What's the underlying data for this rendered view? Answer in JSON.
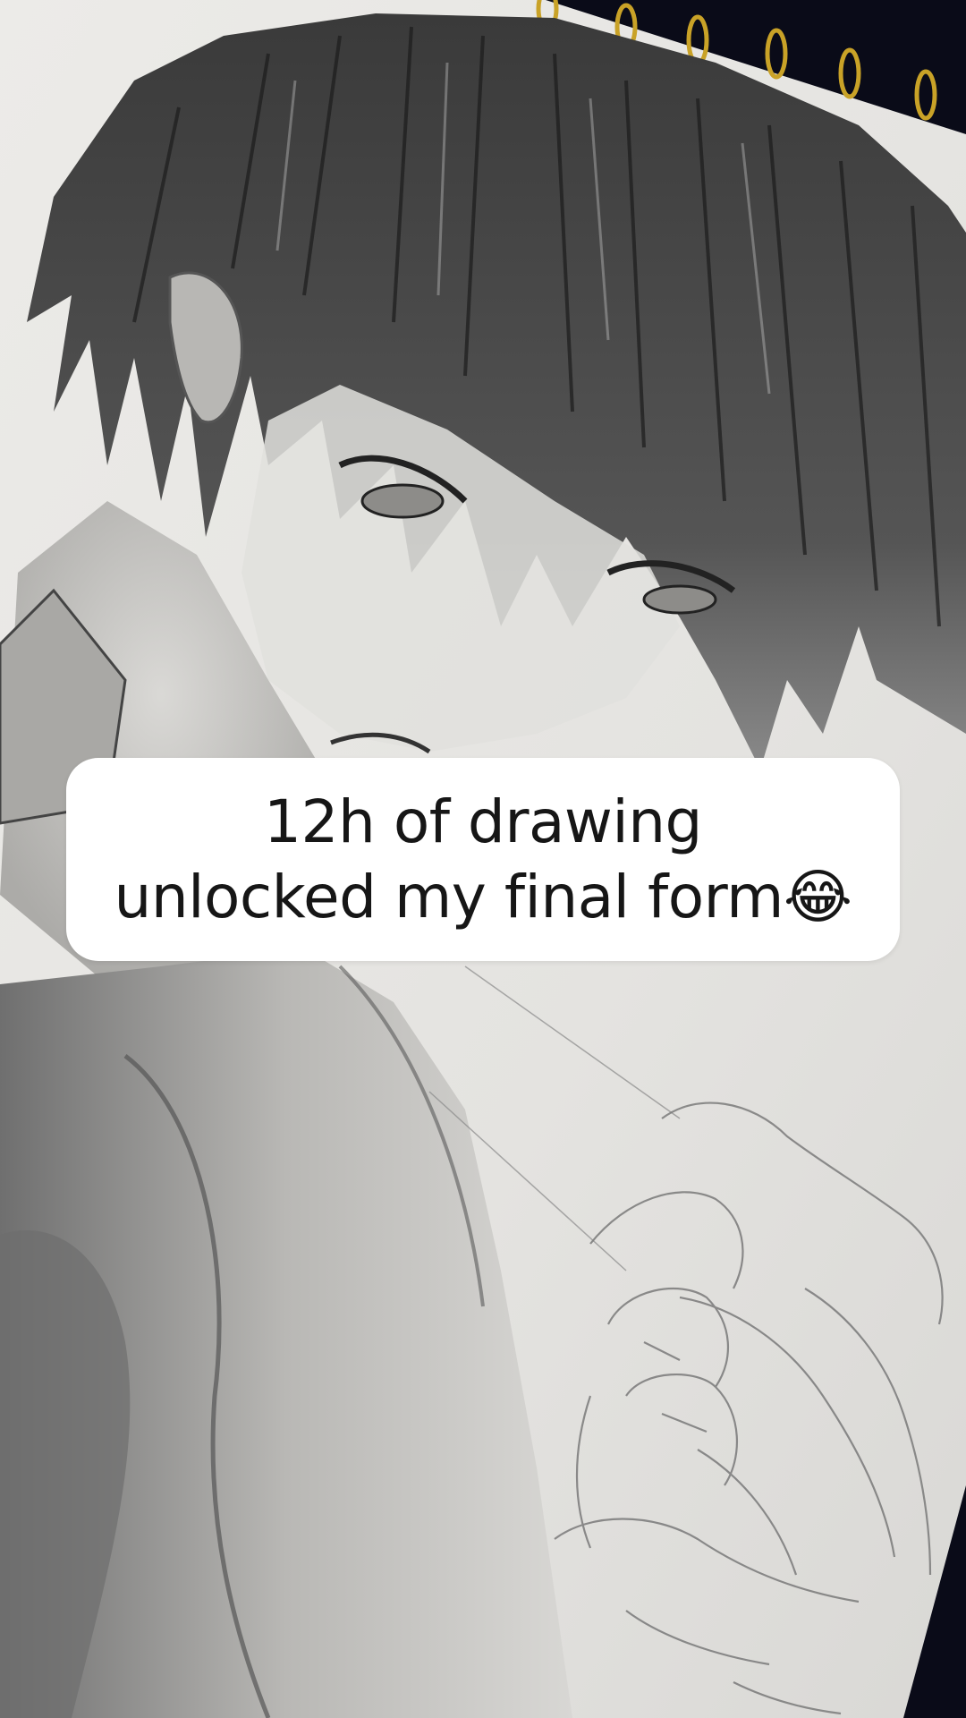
{
  "caption": {
    "line1": "12h of drawing",
    "line2": "unlocked my final form",
    "emoji": "😂"
  },
  "colors": {
    "paper": "#e6e6e4",
    "pencil_dark": "#2b2b2b",
    "pencil_mid": "#7a7a7a",
    "background": "#0a0b18",
    "spiral_gold": "#c9a227",
    "caption_bg": "#ffffff",
    "caption_text": "#161616"
  }
}
